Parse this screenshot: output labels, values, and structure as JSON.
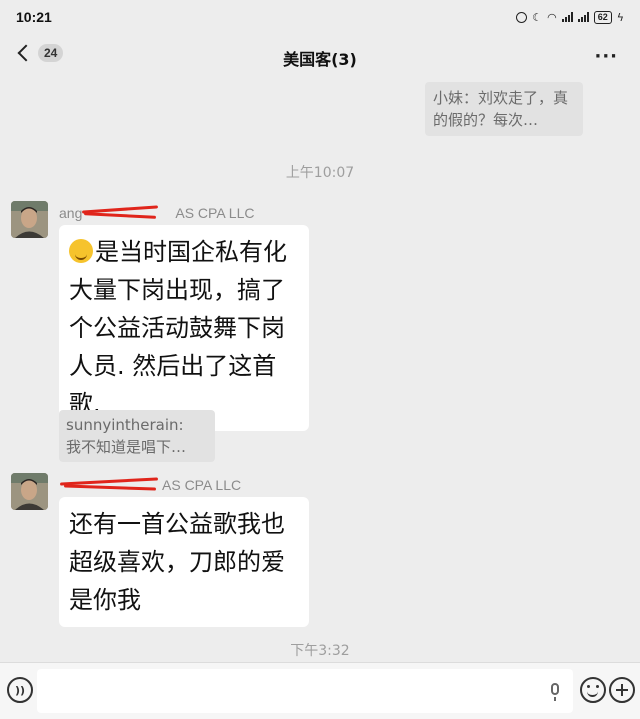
{
  "status_bar": {
    "time": "10:21",
    "battery": "62"
  },
  "header": {
    "unread_count": "24",
    "title": "美国客(3)",
    "more_label": "···"
  },
  "messages": {
    "top_quote": "小妹：刘欢走了，真的假的？每次…",
    "timestamp_1": "上午10:07",
    "msg1": {
      "sender_prefix": "ang",
      "sender_suffix": "AS CPA LLC",
      "text": "是当时国企私有化大量下岗出现，搞了个公益活动鼓舞下岗人员. 然后出了这首歌."
    },
    "quote_reply": {
      "author": "sunnyintherain:",
      "text": "我不知道是唱下…"
    },
    "msg2": {
      "sender_suffix": "AS CPA LLC",
      "text": "还有一首公益歌我也超级喜欢，刀郎的爱是你我"
    },
    "timestamp_2": "下午3:32"
  },
  "input": {
    "placeholder": ""
  },
  "colors": {
    "background": "#ededed",
    "bubble": "#ffffff",
    "quote": "#e2e2e2",
    "redaction": "#e0251b"
  },
  "icons": [
    "back-chevron-icon",
    "more-icon",
    "voice-icon",
    "mic-icon",
    "emoji-icon",
    "plus-icon",
    "thinking-emoji-icon"
  ]
}
